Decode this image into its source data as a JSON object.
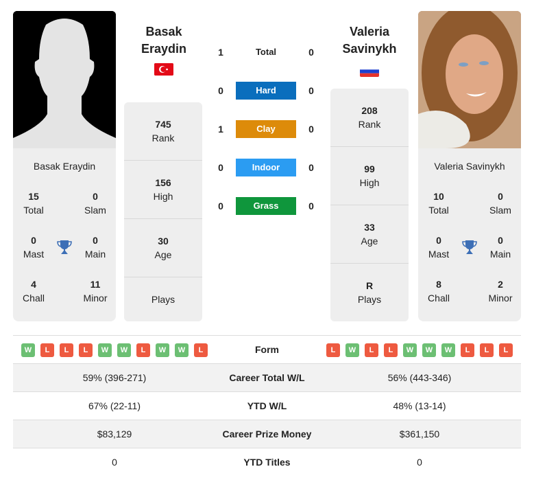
{
  "player_left": {
    "name_line1": "Basak",
    "name_line2": "Eraydin",
    "card_name": "Basak Eraydin",
    "flag": "turkey-flag",
    "photo": "silhouette-placeholder",
    "titles": {
      "total": {
        "value": "15",
        "label": "Total"
      },
      "slam": {
        "value": "0",
        "label": "Slam"
      },
      "mast": {
        "value": "0",
        "label": "Mast"
      },
      "main": {
        "value": "0",
        "label": "Main"
      },
      "chall": {
        "value": "4",
        "label": "Chall"
      },
      "minor": {
        "value": "11",
        "label": "Minor"
      }
    },
    "rank": {
      "value": "745",
      "label": "Rank"
    },
    "high": {
      "value": "156",
      "label": "High"
    },
    "age": {
      "value": "30",
      "label": "Age"
    },
    "plays": {
      "value": "",
      "label": "Plays"
    },
    "form": [
      "W",
      "L",
      "L",
      "L",
      "W",
      "W",
      "L",
      "W",
      "W",
      "L"
    ]
  },
  "player_right": {
    "name_line1": "Valeria",
    "name_line2": "Savinykh",
    "card_name": "Valeria Savinykh",
    "flag": "russia-flag",
    "photo": "player-photo",
    "titles": {
      "total": {
        "value": "10",
        "label": "Total"
      },
      "slam": {
        "value": "0",
        "label": "Slam"
      },
      "mast": {
        "value": "0",
        "label": "Mast"
      },
      "main": {
        "value": "0",
        "label": "Main"
      },
      "chall": {
        "value": "8",
        "label": "Chall"
      },
      "minor": {
        "value": "2",
        "label": "Minor"
      }
    },
    "rank": {
      "value": "208",
      "label": "Rank"
    },
    "high": {
      "value": "99",
      "label": "High"
    },
    "age": {
      "value": "33",
      "label": "Age"
    },
    "plays": {
      "value": "R",
      "label": "Plays"
    },
    "form": [
      "L",
      "W",
      "L",
      "L",
      "W",
      "W",
      "W",
      "L",
      "L",
      "L"
    ]
  },
  "h2h": [
    {
      "surface": "Total",
      "left": "1",
      "right": "0",
      "color": ""
    },
    {
      "surface": "Hard",
      "left": "0",
      "right": "0",
      "color": "#0a6ebd"
    },
    {
      "surface": "Clay",
      "left": "1",
      "right": "0",
      "color": "#dd8b0a"
    },
    {
      "surface": "Indoor",
      "left": "0",
      "right": "0",
      "color": "#2b9cf2"
    },
    {
      "surface": "Grass",
      "left": "0",
      "right": "0",
      "color": "#0f963c"
    }
  ],
  "form_label": "Form",
  "stats": [
    {
      "label": "Career Total W/L",
      "left": "59% (396-271)",
      "right": "56% (443-346)"
    },
    {
      "label": "YTD W/L",
      "left": "67% (22-11)",
      "right": "48% (13-14)"
    },
    {
      "label": "Career Prize Money",
      "left": "$83,129",
      "right": "$361,150"
    },
    {
      "label": "YTD Titles",
      "left": "0",
      "right": "0"
    }
  ],
  "colors": {
    "win": "#6cbf73",
    "loss": "#ee5a40",
    "trophy": "#3d6fb6"
  }
}
